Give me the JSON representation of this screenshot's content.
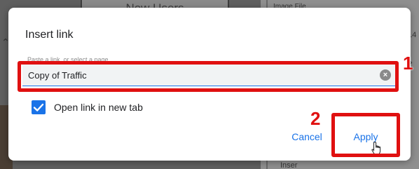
{
  "background": {
    "card_label": "New Users",
    "image_file_label": "Image File",
    "number_fragment": "14",
    "inser_fragment": "Inser"
  },
  "dialog": {
    "title": "Insert link",
    "field_label": "Paste a link, or select a page",
    "field_value": "Copy of Traffic",
    "clear_icon": "clear-icon",
    "checkbox_checked": true,
    "checkbox_label": "Open link in new tab",
    "cancel_label": "Cancel",
    "apply_label": "Apply"
  },
  "annotations": {
    "marker_1": "1",
    "marker_2": "2",
    "color": "#e01010"
  },
  "colors": {
    "accent": "#1a73e8"
  }
}
